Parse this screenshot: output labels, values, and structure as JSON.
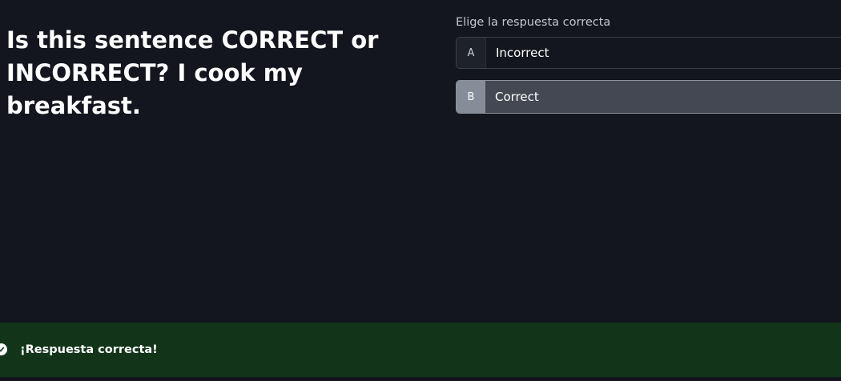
{
  "question": {
    "text": "Is this sentence CORRECT or INCORRECT? I cook my breakfast."
  },
  "answers": {
    "prompt": "Elige la respuesta correcta",
    "options": [
      {
        "letter": "A",
        "label": "Incorrect",
        "selected": false
      },
      {
        "letter": "B",
        "label": "Correct",
        "selected": true
      }
    ]
  },
  "feedback": {
    "icon": "check-circle-icon",
    "message": "¡Respuesta correcta!",
    "status": "correct",
    "color": "#123519"
  },
  "colors": {
    "background": "#13161e",
    "selected_option": "#434852",
    "success_banner": "#123519"
  }
}
